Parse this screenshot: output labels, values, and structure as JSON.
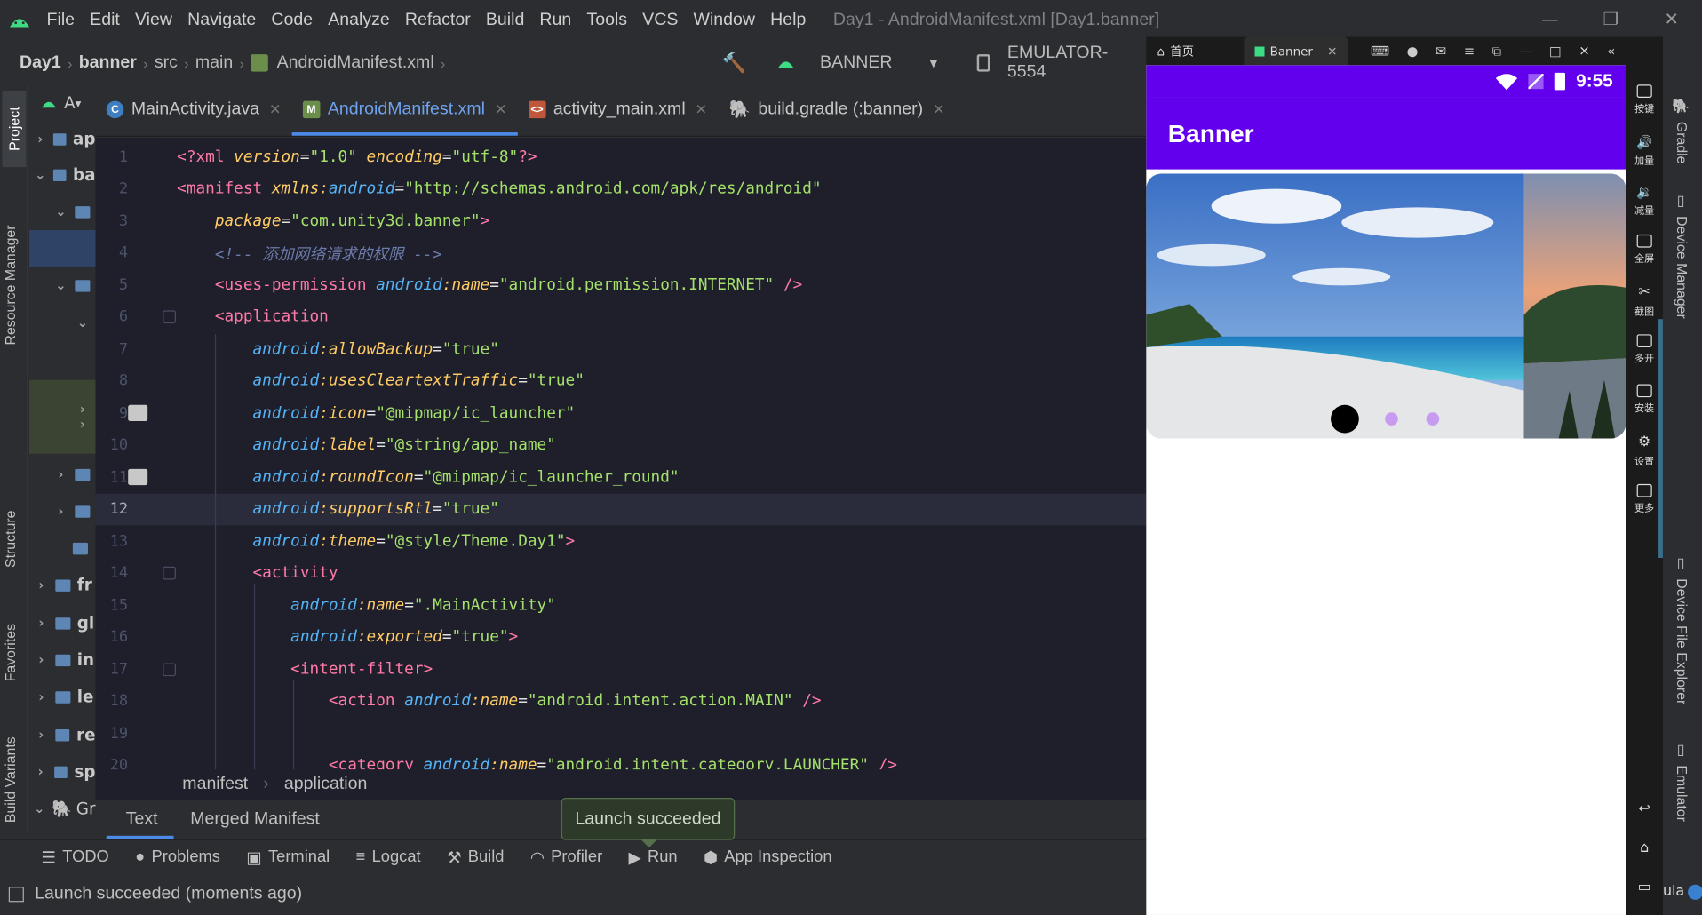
{
  "window": {
    "title": "Day1 - AndroidManifest.xml [Day1.banner]",
    "menu": [
      "File",
      "Edit",
      "View",
      "Navigate",
      "Code",
      "Analyze",
      "Refactor",
      "Build",
      "Run",
      "Tools",
      "VCS",
      "Window",
      "Help"
    ]
  },
  "nav": {
    "crumbs": [
      "Day1",
      "banner",
      "src",
      "main",
      "AndroidManifest.xml"
    ],
    "run_config": "BANNER",
    "device": "EMULATOR-5554"
  },
  "left_strip": {
    "tabs": [
      "Project",
      "Resource Manager",
      "Structure",
      "Favorites",
      "Build Variants"
    ]
  },
  "project_tree": {
    "header": "A",
    "items": [
      {
        "label": "ap",
        "kind": "module"
      },
      {
        "label": "ba",
        "kind": "module"
      },
      {
        "label": "",
        "kind": "folder"
      },
      {
        "label": "",
        "kind": "selected"
      },
      {
        "label": "",
        "kind": "folder"
      },
      {
        "label": "",
        "kind": "folder"
      },
      {
        "label": "fr",
        "kind": "module"
      },
      {
        "label": "gl",
        "kind": "module"
      },
      {
        "label": "in",
        "kind": "module"
      },
      {
        "label": "le",
        "kind": "module"
      },
      {
        "label": "re",
        "kind": "module"
      },
      {
        "label": "sp",
        "kind": "module"
      },
      {
        "label": "Gr",
        "kind": "gradle"
      }
    ]
  },
  "editor_tabs": [
    {
      "label": "MainActivity.java",
      "icon": "java-class-icon",
      "active": false
    },
    {
      "label": "AndroidManifest.xml",
      "icon": "manifest-file-icon",
      "active": true
    },
    {
      "label": "activity_main.xml",
      "icon": "layout-xml-icon",
      "active": false
    },
    {
      "label": "build.gradle (:banner)",
      "icon": "gradle-icon",
      "active": false
    }
  ],
  "code": {
    "current_line": 12,
    "lines": [
      {
        "n": "1",
        "parts": [
          [
            "pi",
            "<?xml "
          ],
          [
            "attr",
            "version"
          ],
          [
            "punc",
            "="
          ],
          [
            "str",
            "\"1.0\""
          ],
          [
            "punc",
            " "
          ],
          [
            "attr",
            "encoding"
          ],
          [
            "punc",
            "="
          ],
          [
            "str",
            "\"utf-8\""
          ],
          [
            "pi",
            "?>"
          ]
        ]
      },
      {
        "n": "2",
        "parts": [
          [
            "tag",
            "<manifest "
          ],
          [
            "attr",
            "xmlns:"
          ],
          [
            "ns",
            "android"
          ],
          [
            "punc",
            "="
          ],
          [
            "str",
            "\"http://schemas.android.com/apk/res/android\""
          ]
        ]
      },
      {
        "n": "3",
        "parts": [
          [
            "punc",
            "    "
          ],
          [
            "attr",
            "package"
          ],
          [
            "punc",
            "="
          ],
          [
            "str",
            "\"com.unity3d.banner\""
          ],
          [
            "tag",
            ">"
          ]
        ]
      },
      {
        "n": "4",
        "parts": [
          [
            "punc",
            "    "
          ],
          [
            "cmt",
            "<!-- 添加网络请求的权限 -->"
          ]
        ]
      },
      {
        "n": "5",
        "parts": [
          [
            "punc",
            "    "
          ],
          [
            "tag",
            "<uses-permission "
          ],
          [
            "ns",
            "android"
          ],
          [
            "attr",
            ":name"
          ],
          [
            "punc",
            "="
          ],
          [
            "str",
            "\"android.permission.INTERNET\""
          ],
          [
            "tag",
            " />"
          ]
        ]
      },
      {
        "n": "6",
        "parts": [
          [
            "punc",
            "    "
          ],
          [
            "tag",
            "<application"
          ]
        ]
      },
      {
        "n": "7",
        "parts": [
          [
            "punc",
            "        "
          ],
          [
            "ns",
            "android"
          ],
          [
            "attr",
            ":allowBackup"
          ],
          [
            "punc",
            "="
          ],
          [
            "str",
            "\"true\""
          ]
        ]
      },
      {
        "n": "8",
        "parts": [
          [
            "punc",
            "        "
          ],
          [
            "ns",
            "android"
          ],
          [
            "attr",
            ":usesCleartextTraffic"
          ],
          [
            "punc",
            "="
          ],
          [
            "str",
            "\"true\""
          ]
        ]
      },
      {
        "n": "9",
        "parts": [
          [
            "punc",
            "        "
          ],
          [
            "ns",
            "android"
          ],
          [
            "attr",
            ":icon"
          ],
          [
            "punc",
            "="
          ],
          [
            "str",
            "\"@mipmap/ic_launcher\""
          ]
        ]
      },
      {
        "n": "10",
        "parts": [
          [
            "punc",
            "        "
          ],
          [
            "ns",
            "android"
          ],
          [
            "attr",
            ":label"
          ],
          [
            "punc",
            "="
          ],
          [
            "str",
            "\"@string/app_name\""
          ]
        ]
      },
      {
        "n": "11",
        "parts": [
          [
            "punc",
            "        "
          ],
          [
            "ns",
            "android"
          ],
          [
            "attr",
            ":roundIcon"
          ],
          [
            "punc",
            "="
          ],
          [
            "str",
            "\"@mipmap/ic_launcher_round\""
          ]
        ]
      },
      {
        "n": "12",
        "parts": [
          [
            "punc",
            "        "
          ],
          [
            "ns",
            "android"
          ],
          [
            "attr",
            ":supportsRtl"
          ],
          [
            "punc",
            "="
          ],
          [
            "str",
            "\"true\""
          ]
        ]
      },
      {
        "n": "13",
        "parts": [
          [
            "punc",
            "        "
          ],
          [
            "ns",
            "android"
          ],
          [
            "attr",
            ":theme"
          ],
          [
            "punc",
            "="
          ],
          [
            "str",
            "\"@style/Theme.Day1\""
          ],
          [
            "tag",
            ">"
          ]
        ]
      },
      {
        "n": "14",
        "parts": [
          [
            "punc",
            "        "
          ],
          [
            "tag",
            "<activity"
          ]
        ]
      },
      {
        "n": "15",
        "parts": [
          [
            "punc",
            "            "
          ],
          [
            "ns",
            "android"
          ],
          [
            "attr",
            ":name"
          ],
          [
            "punc",
            "="
          ],
          [
            "str",
            "\".MainActivity\""
          ]
        ]
      },
      {
        "n": "16",
        "parts": [
          [
            "punc",
            "            "
          ],
          [
            "ns",
            "android"
          ],
          [
            "attr",
            ":exported"
          ],
          [
            "punc",
            "="
          ],
          [
            "str",
            "\"true\""
          ],
          [
            "tag",
            ">"
          ]
        ]
      },
      {
        "n": "17",
        "parts": [
          [
            "punc",
            "            "
          ],
          [
            "tag",
            "<intent-filter>"
          ]
        ]
      },
      {
        "n": "18",
        "parts": [
          [
            "punc",
            "                "
          ],
          [
            "tag",
            "<action "
          ],
          [
            "ns",
            "android"
          ],
          [
            "attr",
            ":name"
          ],
          [
            "punc",
            "="
          ],
          [
            "str",
            "\"android.intent.action.MAIN\""
          ],
          [
            "tag",
            " />"
          ]
        ]
      },
      {
        "n": "19",
        "parts": []
      },
      {
        "n": "20",
        "parts": [
          [
            "punc",
            "                "
          ],
          [
            "tag",
            "<category "
          ],
          [
            "ns",
            "android"
          ],
          [
            "attr",
            ":name"
          ],
          [
            "punc",
            "="
          ],
          [
            "str",
            "\"android.intent.category.LAUNCHER\""
          ],
          [
            "tag",
            " />"
          ]
        ]
      }
    ]
  },
  "xml_breadcrumb": [
    "manifest",
    "application"
  ],
  "subtabs": [
    "Text",
    "Merged Manifest"
  ],
  "popup": "Launch succeeded",
  "bottom_tools": [
    "TODO",
    "Problems",
    "Terminal",
    "Logcat",
    "Build",
    "Profiler",
    "Run",
    "App Inspection"
  ],
  "status": "Launch succeeded (moments ago)",
  "emulator": {
    "tabs": [
      "首页",
      "Banner"
    ],
    "time": "9:55",
    "app_title": "Banner",
    "side_buttons": [
      "按键",
      "加量",
      "减量",
      "全屏",
      "截图",
      "多开",
      "安装",
      "设置",
      "更多"
    ]
  },
  "right_strip": {
    "tabs": [
      "Gradle",
      "Device Manager",
      "Device File Explorer",
      "Emulator"
    ],
    "bottom_text": "ula"
  },
  "colors": {
    "accent": "#4c8ae8",
    "app_purple": "#6200ee"
  }
}
